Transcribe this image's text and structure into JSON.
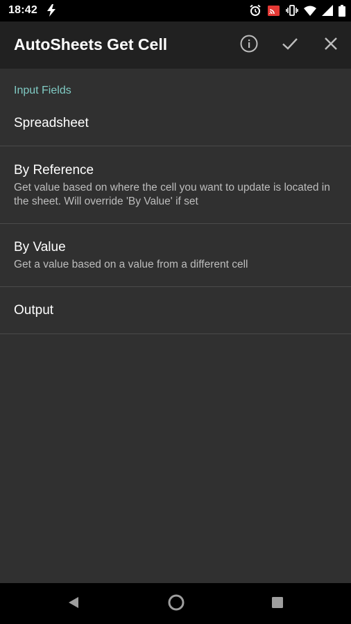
{
  "status_bar": {
    "time": "18:42",
    "icons": [
      "lightning-icon",
      "alarm-icon",
      "cast-icon",
      "vibrate-icon",
      "wifi-icon",
      "signal-icon",
      "battery-icon"
    ]
  },
  "app_bar": {
    "title": "AutoSheets Get Cell",
    "actions": [
      "info-icon",
      "check-icon",
      "close-icon"
    ]
  },
  "section": {
    "header": "Input Fields"
  },
  "items": [
    {
      "title": "Spreadsheet",
      "subtitle": ""
    },
    {
      "title": "By Reference",
      "subtitle": "Get value based on where the cell you want to update is located in the sheet. Will override 'By Value' if set"
    },
    {
      "title": "By Value",
      "subtitle": "Get a value based on a value from a different cell"
    },
    {
      "title": "Output",
      "subtitle": ""
    }
  ],
  "nav_bar": {
    "buttons": [
      "back-icon",
      "home-icon",
      "recents-icon"
    ]
  },
  "colors": {
    "accent": "#80cbc4",
    "app_bar": "#212121",
    "background": "#303030",
    "divider": "#4a4a4a"
  }
}
